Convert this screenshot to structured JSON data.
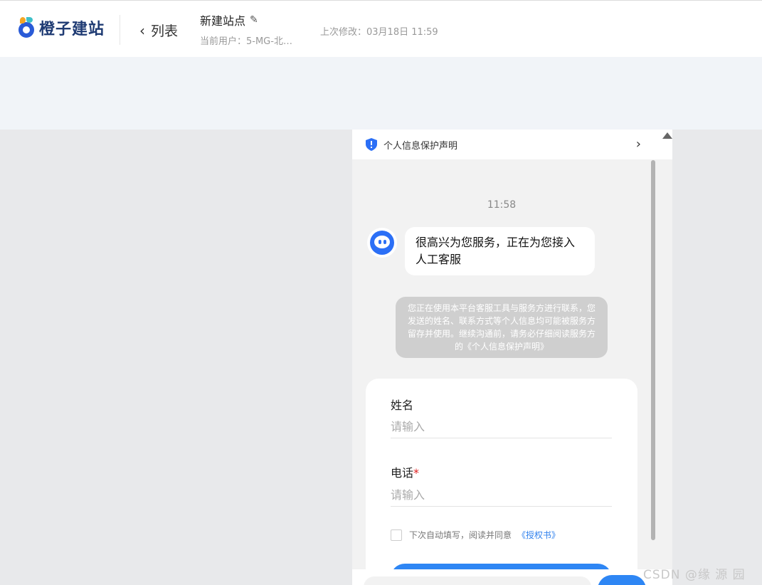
{
  "header": {
    "logo_text": "橙子建站",
    "back_label": "列表",
    "site_title": "新建站点",
    "current_user": "当前用户：5-MG-北…",
    "last_modified": "上次修改：03月18日 11:59"
  },
  "panel": {
    "notice": "个人信息保护声明",
    "time": "11:58",
    "bot_message": "很高兴为您服务，正在为您接入人工客服",
    "system_message": "您正在使用本平台客服工具与服务方进行联系，您发送的姓名、联系方式等个人信息均可能被服务方留存并使用。继续沟通前，请务必仔细阅读服务方的《个人信息保护声明》"
  },
  "form": {
    "name_label": "姓名",
    "name_placeholder": "请输入",
    "phone_label": "电话",
    "phone_required": "*",
    "phone_placeholder": "请输入",
    "agree_text": "下次自动填写，阅读并同意",
    "agree_link": "《授权书》"
  },
  "watermark": "CSDN @缘  源  园",
  "colors": {
    "primary": "#2e86f4",
    "brand": "#1f3b73",
    "required": "#e02020"
  }
}
